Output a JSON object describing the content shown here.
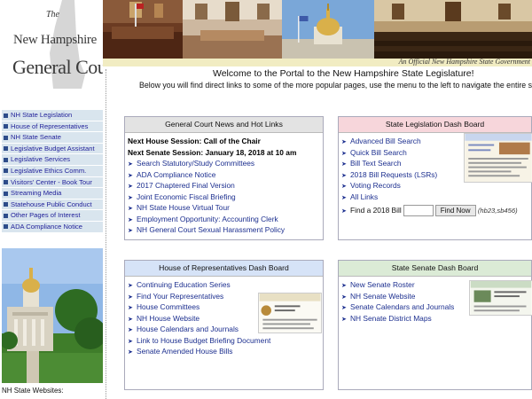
{
  "header": {
    "logo_the": "The",
    "logo_line1": "New Hampshire",
    "logo_line2": "General Court",
    "official": "An Official New Hampshire State Government"
  },
  "nav": [
    {
      "label": "NH State Legislation"
    },
    {
      "label": "House of Representatives"
    },
    {
      "label": "NH State Senate"
    },
    {
      "label": "Legislative Budget Assistant"
    },
    {
      "label": "Legislative Services"
    },
    {
      "label": "Legislative Ethics Comm."
    },
    {
      "label": "Visitors' Center - Book Tour"
    },
    {
      "label": "Streaming Media"
    },
    {
      "label": "Statehouse Public Conduct"
    },
    {
      "label": "Other Pages of Interest"
    },
    {
      "label": "ADA Compliance Notice"
    }
  ],
  "sidebar": {
    "websites_label": "NH State Websites:"
  },
  "main": {
    "welcome": "Welcome to the Portal to the New Hampshire State Legislature!",
    "subtitle": "Below you will find direct links to some of the more popular pages, use the menu to the left to navigate the entire site."
  },
  "news": {
    "title": "General Court News and Hot Links",
    "session_house": "Next House Session: Call of the Chair",
    "session_senate": "Next Senate Session: January 18, 2018 at 10 am",
    "links": [
      "Search Statutory/Study Committees",
      "ADA Compliance Notice",
      "2017 Chaptered Final Version",
      "Joint Economic Fiscal Briefing",
      "NH State House Virtual Tour",
      "Employment Opportunity: Accounting Clerk",
      "NH General Court Sexual Harassment Policy"
    ]
  },
  "legislation": {
    "title": "State Legislation Dash Board",
    "links": [
      "Advanced Bill Search",
      "Quick Bill Search",
      "Bill Text Search",
      "2018 Bill Requests (LSRs)",
      "Voting Records",
      "All Links"
    ],
    "find_label": "Find a 2018 Bill",
    "find_value": "",
    "find_button": "Find Now",
    "find_hint": "(hb23,sb456)"
  },
  "house": {
    "title": "House of Representatives Dash Board",
    "links": [
      "Continuing Education Series",
      "Find Your Representatives",
      "House Committees",
      "NH House Website",
      "House Calendars and Journals",
      "Link to House Budget Briefing Document",
      "Senate Amended House Bills"
    ]
  },
  "senate": {
    "title": "State Senate Dash Board",
    "links": [
      "New Senate Roster",
      "NH Senate Website",
      "Senate Calendars and Journals",
      "NH Senate District Maps"
    ]
  },
  "colors": {
    "link": "#1c2f8f",
    "nav_bg": "#d9e5ee",
    "news_head": "#e3e3e3",
    "legislation_head": "#f7d6db",
    "house_head": "#d6e3f7",
    "senate_head": "#dbebd6",
    "official_bar": "#f1ecc2"
  }
}
